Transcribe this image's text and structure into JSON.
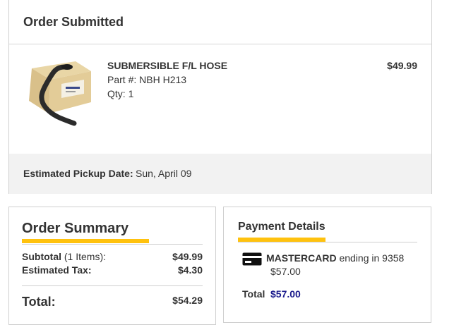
{
  "order": {
    "title": "Order Submitted",
    "item": {
      "name": "SUBMERSIBLE F/L HOSE",
      "part_label": "Part #:",
      "part_number": "NBH H213",
      "qty_label": "Qty:",
      "qty": "1",
      "price": "$49.99",
      "image_icon": "hose-box-image"
    },
    "pickup": {
      "label": "Estimated Pickup Date:",
      "date": "Sun, April 09"
    }
  },
  "summary": {
    "title": "Order Summary",
    "subtotal_label": "Subtotal",
    "subtotal_items": "(1 Items):",
    "subtotal_value": "$49.99",
    "tax_label": "Estimated Tax:",
    "tax_value": "$4.30",
    "total_label": "Total:",
    "total_value": "$54.29",
    "accent_color": "#ffc20e"
  },
  "payment": {
    "title": "Payment Details",
    "card_brand": "MASTERCARD",
    "card_ending_text": "ending in 9358",
    "card_amount": "$57.00",
    "total_label": "Total",
    "total_value": "$57.00",
    "card_icon": "credit-card-icon",
    "total_color": "#1a1a8c"
  }
}
